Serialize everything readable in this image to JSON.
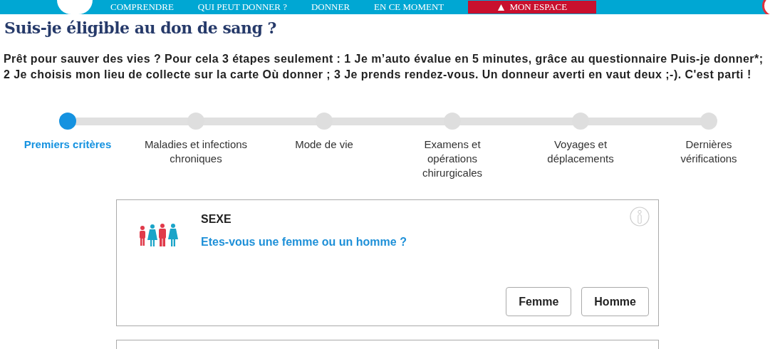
{
  "nav": {
    "items": [
      "COMPRENDRE",
      "QUI PEUT DONNER ?",
      "DONNER",
      "EN CE MOMENT"
    ],
    "account": "MON ESPACE"
  },
  "title": "Suis-je éligible au don de sang ?",
  "intro": "Prêt pour sauver des vies ? Pour cela 3 étapes seulement : 1 Je m’auto évalue en 5 minutes, grâce au questionnaire Puis-je donner*; 2 Je choisis mon lieu de collecte sur la carte Où donner ; 3 Je prends rendez-vous. Un donneur averti en vaut deux ;-). C'est parti !",
  "steps": [
    {
      "label": "Premiers critères",
      "selected": true
    },
    {
      "label": "Maladies et infections chroniques",
      "selected": false
    },
    {
      "label": "Mode de vie",
      "selected": false
    },
    {
      "label": "Examens et opérations chirurgicales",
      "selected": false
    },
    {
      "label": "Voyages et déplacements",
      "selected": false
    },
    {
      "label": "Dernières vérifications",
      "selected": false
    }
  ],
  "question": {
    "heading": "SEXE",
    "text": "Etes-vous une femme ou un homme ?",
    "answers": [
      "Femme",
      "Homme"
    ]
  }
}
